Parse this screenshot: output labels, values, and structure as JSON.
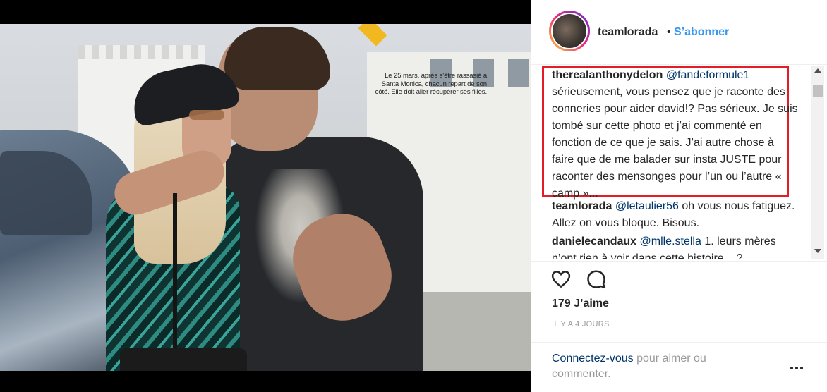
{
  "photo": {
    "caption": "Le 25 mars, après s’être rassasié à Santa Monica, chacun repart de son côté. Elle doit aller récupérer ses filles."
  },
  "header": {
    "username": "teamlorada",
    "separator": "•",
    "follow_label": "S’abonner"
  },
  "comments": [
    {
      "username": "therealanthonydelon",
      "mention": "@fandeformule1",
      "text": "sérieusement, vous pensez que je raconte des conneries pour aider david!? Pas sérieux. Je suis tombé sur cette photo et j’ai commenté en fonction de ce que je sais. J’ai autre chose à faire que de me balader sur insta JUSTE pour raconter des mensonges pour l’un ou l’autre «  camp »..."
    },
    {
      "username": "teamlorada",
      "mention": "@letaulier56",
      "text": "oh vous nous fatiguez. Allez on vous bloque. Bisous."
    },
    {
      "username": "danielecandaux",
      "mention": "@mlle.stella",
      "text": "1. leurs mères n’ont rien à voir dans cette histoire... ?"
    }
  ],
  "actions": {
    "like_icon": "heart-icon",
    "comment_icon": "comment-bubble-icon"
  },
  "likes": "179 J’aime",
  "time": "IL Y A 4 JOURS",
  "footer": {
    "login_link": "Connectez-vous",
    "login_rest": " pour aimer ou commenter.",
    "more_icon": "more-options-icon"
  },
  "colors": {
    "link_blue": "#3897f0",
    "mention_navy": "#003569",
    "highlight_red": "#e31c25"
  }
}
